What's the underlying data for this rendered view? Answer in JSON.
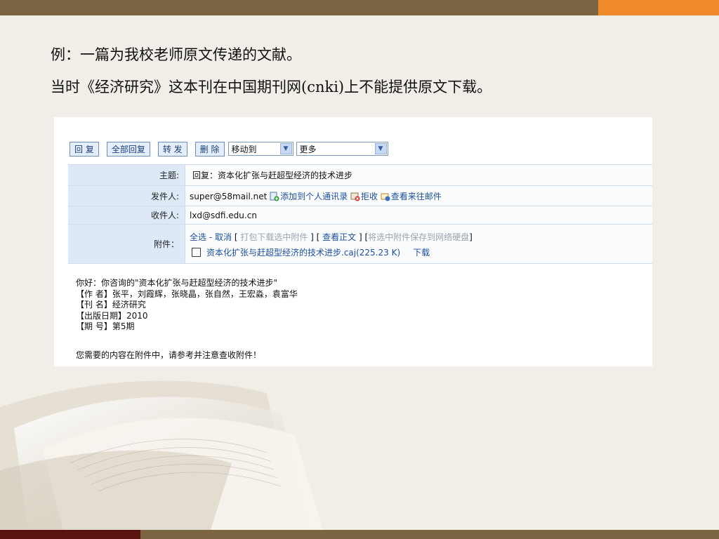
{
  "slide": {
    "line1": "例：一篇为我校老师原文传递的文献。",
    "line2": "当时《经济研究》这本刊在中国期刊网(cnki)上不能提供原文下载。"
  },
  "toolbar": {
    "reply": "回 复",
    "reply_all": "全部回复",
    "forward": "转 发",
    "delete": "删 除",
    "move_to": "移动到",
    "more": "更多"
  },
  "header": {
    "subject_label": "主题:",
    "subject": "回复：资本化扩张与赶超型经济的技术进步",
    "from_label": "发件人:",
    "from": "super@58mail.net",
    "add_contact": "添加到个人通讯录",
    "reject": "拒收",
    "view_history": "查看来往邮件",
    "to_label": "收件人:",
    "to": "lxd@sdfi.edu.cn",
    "attach_label": "附件：",
    "select_all": "全选",
    "sep": " - ",
    "cancel": "取消",
    "bracket_open": " [ ",
    "download_selected": "打包下载选中附件",
    "bracket_mid": " ] [ ",
    "view_body": "查看正文",
    "bracket_mid2": " ] [",
    "save_to_disk": "将选中附件保存到网络硬盘",
    "bracket_close": "]",
    "file_name": "资本化扩张与赶超型经济的技术进步.caj(225.23 K)",
    "download": "下载"
  },
  "body": {
    "greeting": "你好：你咨询的\"资本化扩张与赶超型经济的技术进步\"",
    "author": "【作 者】张平，刘霞辉，张晓晶，张自然，王宏淼，袁富华",
    "journal": "【刊 名】经济研究",
    "pub_date": "【出版日期】2010",
    "issue": "【期 号】第5期",
    "notice": "您需要的内容在附件中，请参考并注意查收附件！"
  },
  "colors": {
    "top_band": "#7a6442",
    "accent": "#ee8a2a",
    "label_bg": "#dde9f7",
    "link": "#1c4f9a"
  }
}
